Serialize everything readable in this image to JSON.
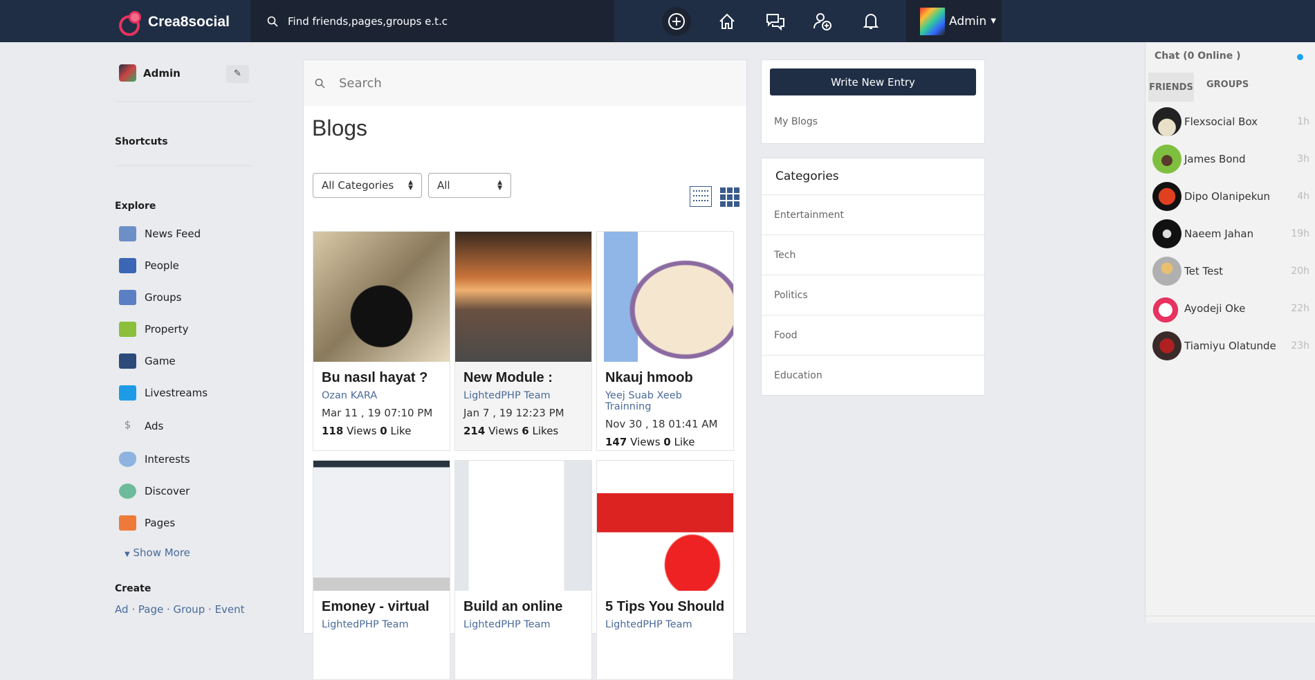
{
  "header": {
    "brand": "Crea8social",
    "search_placeholder": "Find friends,pages,groups e.t.c",
    "user": "Admin"
  },
  "sidebar": {
    "user": "Admin",
    "shortcuts": "Shortcuts",
    "explore": "Explore",
    "items": [
      {
        "label": "News Feed",
        "color": "#6d8fc7"
      },
      {
        "label": "People",
        "color": "#3b66b5"
      },
      {
        "label": "Groups",
        "color": "#5a7fc4"
      },
      {
        "label": "Property",
        "color": "#8bbf3c"
      },
      {
        "label": "Game",
        "color": "#2c4a7a"
      },
      {
        "label": "Livestreams",
        "color": "#1d9be6"
      },
      {
        "label": "Ads",
        "color": "#aaaaaa"
      },
      {
        "label": "Interests",
        "color": "#8fb3e0"
      },
      {
        "label": "Discover",
        "color": "#6dbb9c"
      },
      {
        "label": "Pages",
        "color": "#ee7a3a"
      }
    ],
    "show_more": "Show More",
    "create": "Create",
    "create_links": [
      "Ad",
      "Page",
      "Group",
      "Event"
    ],
    "dot": "·"
  },
  "main": {
    "search_placeholder": "Search",
    "title": "Blogs",
    "category_select": "All Categories",
    "filter_select": "All",
    "blogs": [
      {
        "title": "Bu nasıl hayat ?",
        "author": "Ozan KARA",
        "date": "Mar 11 , 19 07:10 PM",
        "views": "118",
        "views_label": "Views",
        "likes": "0",
        "likes_label": "Like"
      },
      {
        "title": "New Module :",
        "author": "LightedPHP Team",
        "date": "Jan 7 , 19 12:23 PM",
        "views": "214",
        "views_label": "Views",
        "likes": "6",
        "likes_label": "Likes"
      },
      {
        "title": "Nkauj hmoob",
        "author": "Yeej Suab Xeeb Trainning",
        "date": "Nov 30 , 18 01:41 AM",
        "views": "147",
        "views_label": "Views",
        "likes": "0",
        "likes_label": "Like"
      },
      {
        "title": "Emoney - virtual",
        "author": "LightedPHP Team"
      },
      {
        "title": "Build an online",
        "author": "LightedPHP Team"
      },
      {
        "title": "5 Tips You Should",
        "author": "LightedPHP Team"
      }
    ]
  },
  "right": {
    "write_button": "Write New Entry",
    "my_blogs": "My Blogs",
    "categories_title": "Categories",
    "categories": [
      "Entertainment",
      "Tech",
      "Politics",
      "Food",
      "Education"
    ]
  },
  "chat": {
    "title": "Chat (0 Online )",
    "tabs": [
      "FRIENDS",
      "GROUPS"
    ],
    "online_color": "#1da1f2",
    "friends": [
      {
        "name": "Flexsocial Box",
        "time": "1h"
      },
      {
        "name": "James Bond",
        "time": "3h"
      },
      {
        "name": "Dipo Olanipekun",
        "time": "4h"
      },
      {
        "name": "Naeem Jahan",
        "time": "19h"
      },
      {
        "name": "Tet Test",
        "time": "20h"
      },
      {
        "name": "Ayodeji Oke",
        "time": "22h"
      },
      {
        "name": "Tiamiyu Olatunde",
        "time": "23h"
      }
    ]
  }
}
